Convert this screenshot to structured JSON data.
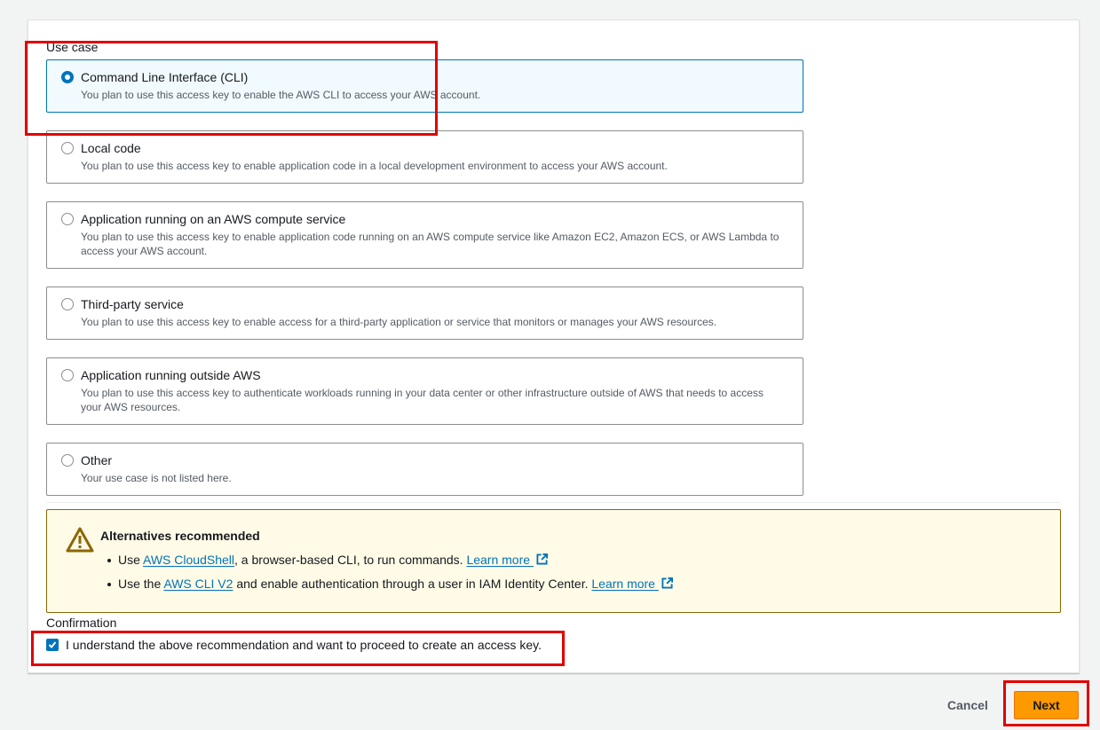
{
  "use_case": {
    "label": "Use case",
    "selected_index": 0,
    "options": [
      {
        "title": "Command Line Interface (CLI)",
        "description": "You plan to use this access key to enable the AWS CLI to access your AWS account.",
        "selected": true
      },
      {
        "title": "Local code",
        "description": "You plan to use this access key to enable application code in a local development environment to access your AWS account.",
        "selected": false
      },
      {
        "title": "Application running on an AWS compute service",
        "description": "You plan to use this access key to enable application code running on an AWS compute service like Amazon EC2, Amazon ECS, or AWS Lambda to access your AWS account.",
        "selected": false
      },
      {
        "title": "Third-party service",
        "description": "You plan to use this access key to enable access for a third-party application or service that monitors or manages your AWS resources.",
        "selected": false
      },
      {
        "title": "Application running outside AWS",
        "description": "You plan to use this access key to authenticate workloads running in your data center or other infrastructure outside of AWS that needs to access your AWS resources.",
        "selected": false
      },
      {
        "title": "Other",
        "description": "Your use case is not listed here.",
        "selected": false
      }
    ]
  },
  "alert": {
    "icon": "warning-icon",
    "title": "Alternatives recommended",
    "items": [
      {
        "prefix": "Use ",
        "link": "AWS CloudShell",
        "middle": ", a browser-based CLI, to run commands. ",
        "learn_more": "Learn more"
      },
      {
        "prefix": "Use the ",
        "link": "AWS CLI V2",
        "middle": " and enable authentication through a user in IAM Identity Center. ",
        "learn_more": "Learn more"
      }
    ]
  },
  "confirmation": {
    "label": "Confirmation",
    "checkbox_text": "I understand the above recommendation and want to proceed to create an access key.",
    "checked": true
  },
  "footer": {
    "cancel_label": "Cancel",
    "next_label": "Next"
  },
  "colors": {
    "accent": "#0073bb",
    "primary_button": "#ff9900",
    "warning_bg": "#fffbe7",
    "warning_border": "#8d6605",
    "annotation_red": "#e00000"
  }
}
